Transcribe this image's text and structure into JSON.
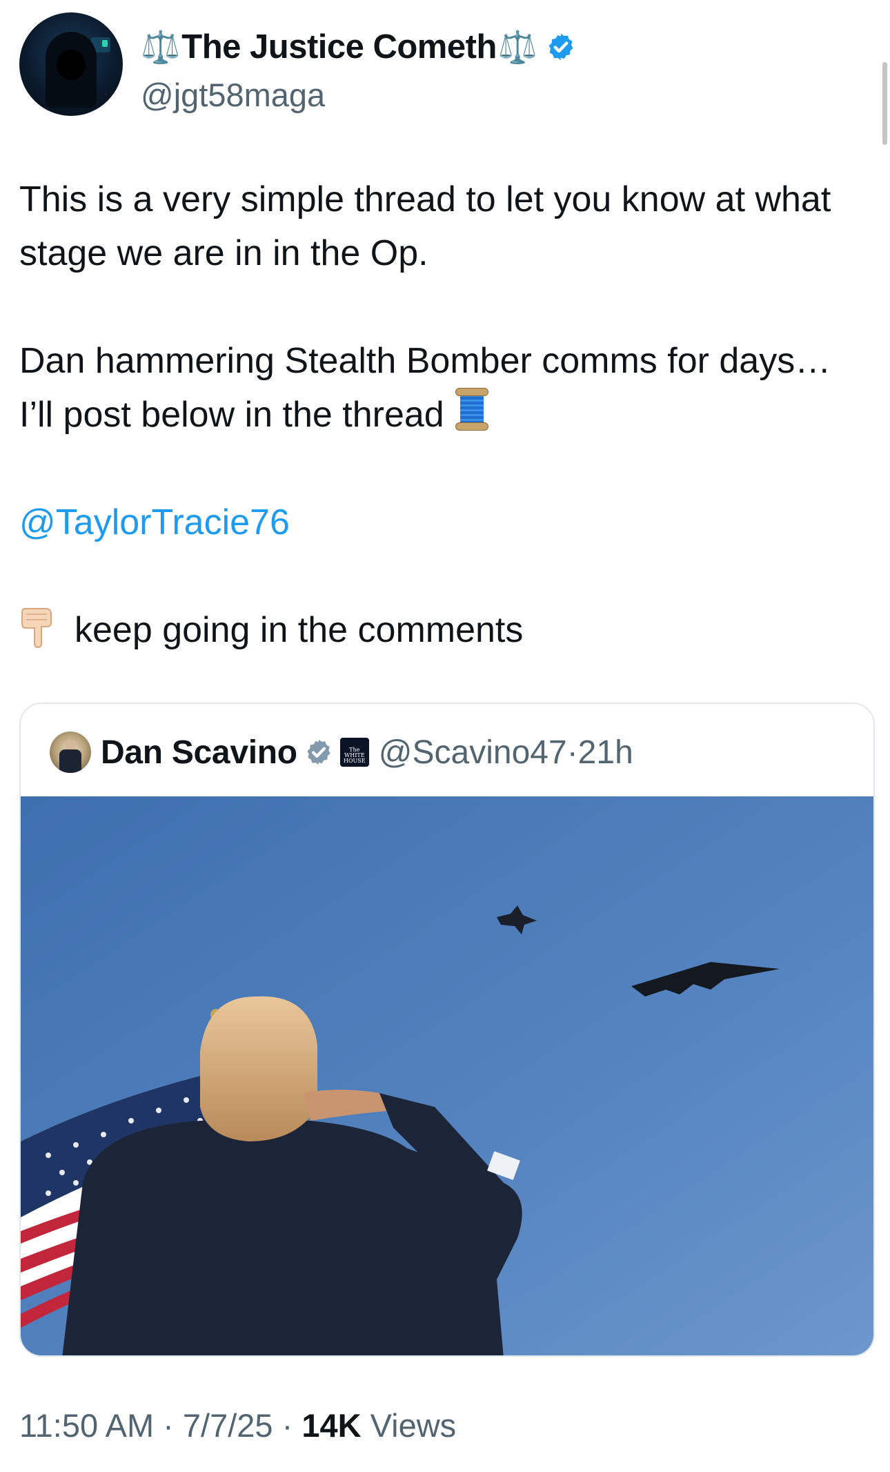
{
  "author": {
    "display_name": "The Justice Cometh",
    "scale_left": "⚖️",
    "scale_right": "⚖️",
    "handle": "@jgt58maga",
    "verified": true
  },
  "tweet": {
    "line1": "This is a very simple thread to let you know at what stage we are in in the Op.",
    "line2": "Dan hammering Stealth Bomber comms for days… I’ll post below in the thread",
    "mention": "@TaylorTracie76",
    "line3": "keep going in the comments",
    "emoji_spool": "thread-spool",
    "emoji_hand": "backhand-index-pointing-down"
  },
  "quoted_tweet": {
    "display_name": "Dan Scavino",
    "handle": "@Scavino47",
    "separator": "·",
    "time_ago": "21h",
    "affiliate_badge": "The WHITE HOUSE",
    "photo": "man-saluting-stealth-bomber-and-jet-flyover-with-flag"
  },
  "meta": {
    "time": "11:50 AM",
    "separator": "·",
    "date": "7/7/25",
    "views_count": "14K",
    "views_label": "Views"
  },
  "colors": {
    "link": "#1d9bf0",
    "verified": "#1d9bf0",
    "secondary_text": "#536471",
    "sky": "#5a87c2"
  }
}
